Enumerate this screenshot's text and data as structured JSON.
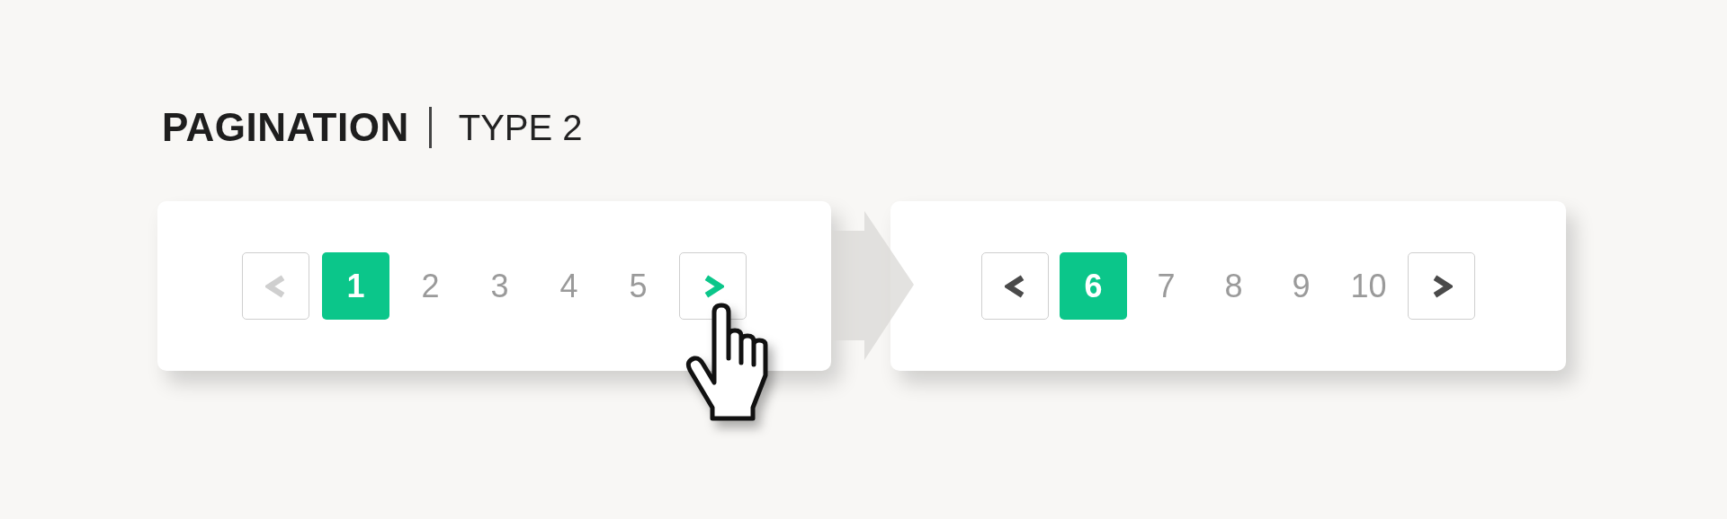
{
  "title": {
    "main": "PAGINATION",
    "sub": "TYPE 2"
  },
  "paginations": [
    {
      "previous": {
        "disabled": true,
        "hovered": false
      },
      "pages": [
        {
          "label": "1",
          "selected": true
        },
        {
          "label": "2",
          "selected": false
        },
        {
          "label": "3",
          "selected": false
        },
        {
          "label": "4",
          "selected": false
        },
        {
          "label": "5",
          "selected": false
        }
      ],
      "next": {
        "disabled": false,
        "hovered": true
      }
    },
    {
      "previous": {
        "disabled": false,
        "hovered": false
      },
      "pages": [
        {
          "label": "6",
          "selected": true
        },
        {
          "label": "7",
          "selected": false
        },
        {
          "label": "8",
          "selected": false
        },
        {
          "label": "9",
          "selected": false
        },
        {
          "label": "10",
          "selected": false
        }
      ],
      "next": {
        "disabled": false,
        "hovered": false
      }
    }
  ]
}
